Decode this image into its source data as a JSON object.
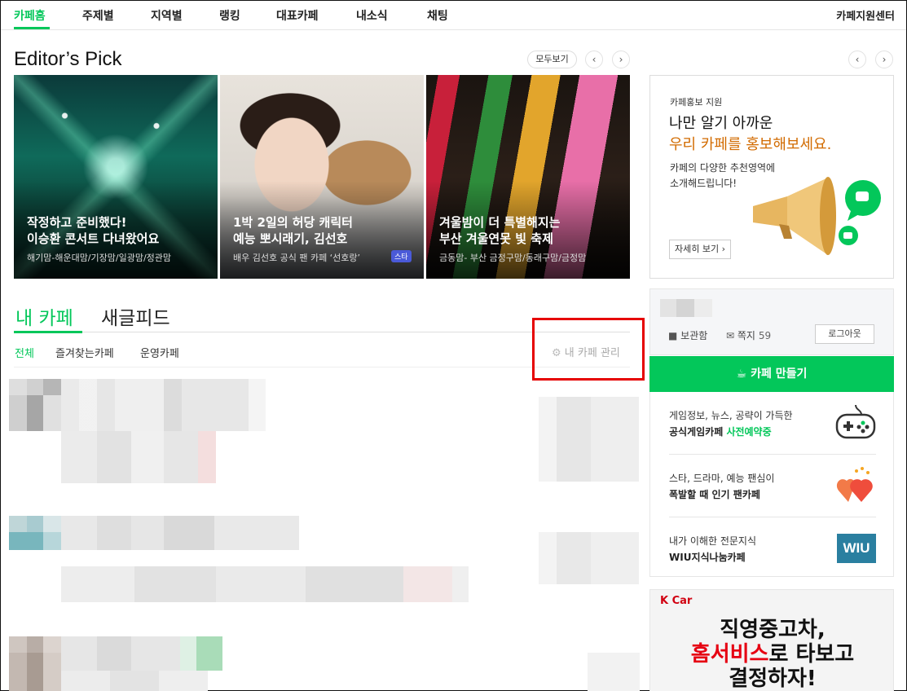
{
  "nav": {
    "items": [
      "카페홈",
      "주제별",
      "지역별",
      "랭킹",
      "대표카페",
      "내소식",
      "채팅"
    ],
    "support": "카페지원센터"
  },
  "editors_pick": {
    "title": "Editor’s Pick",
    "see_all": "모두보기",
    "cards": [
      {
        "line1": "작정하고 준비했다!",
        "line2": "이승환 콘서트 다녀왔어요",
        "meta": "해기맘-해운대맘/기장맘/일광맘/정관맘"
      },
      {
        "line1": "1박 2일의 허당 캐릭터",
        "line2": "예능 뽀시래기, 김선호",
        "meta": "배우 김선호 공식 팬 카페 ‘선호랑’",
        "badge": "스타"
      },
      {
        "line1": "겨울밤이 더 특별해지는",
        "line2": "부산 겨울연못 빛 축제",
        "meta": "금동맘- 부산 금정구맘/동래구맘/금정맘"
      }
    ]
  },
  "my_cafe": {
    "tab_my": "내 카페",
    "tab_new": "새글피드",
    "subtabs": [
      "전체",
      "즐겨찾는카페",
      "운영카페"
    ],
    "manage": "내 카페 관리"
  },
  "promo": {
    "label": "카페홍보 지원",
    "headline1": "나만 알기 아까운",
    "headline2": "우리 카페를 홍보해보세요.",
    "desc1": "카페의 다양한 추천영역에",
    "desc2": "소개해드립니다!",
    "more": "자세히 보기"
  },
  "account": {
    "box": "보관함",
    "note_label": "쪽지",
    "note_count": "59",
    "logout": "로그아웃"
  },
  "make_cafe": "카페 만들기",
  "links": [
    {
      "line1": "게임정보, 뉴스, 공략이 가득한",
      "line2a": "공식게임카페",
      "line2b": "사전예약중"
    },
    {
      "line1": "스타, 드라마, 예능 팬심이",
      "line2a": "폭발할 때 인기 팬카페",
      "line2b": ""
    },
    {
      "line1": "내가 이해한 전문지식",
      "line2a": "WIU지식나눔카페",
      "line2b": "",
      "icon_text": "WIU"
    }
  ],
  "ad": {
    "brand": "K Car",
    "line1": "직영중고차,",
    "line2a": "홈서비스",
    "line2b": "로 타보고",
    "line3": "결정하자!"
  },
  "colors": {
    "accent": "#03c75a",
    "highlight": "#e60000",
    "promo_orange": "#d26b00"
  }
}
